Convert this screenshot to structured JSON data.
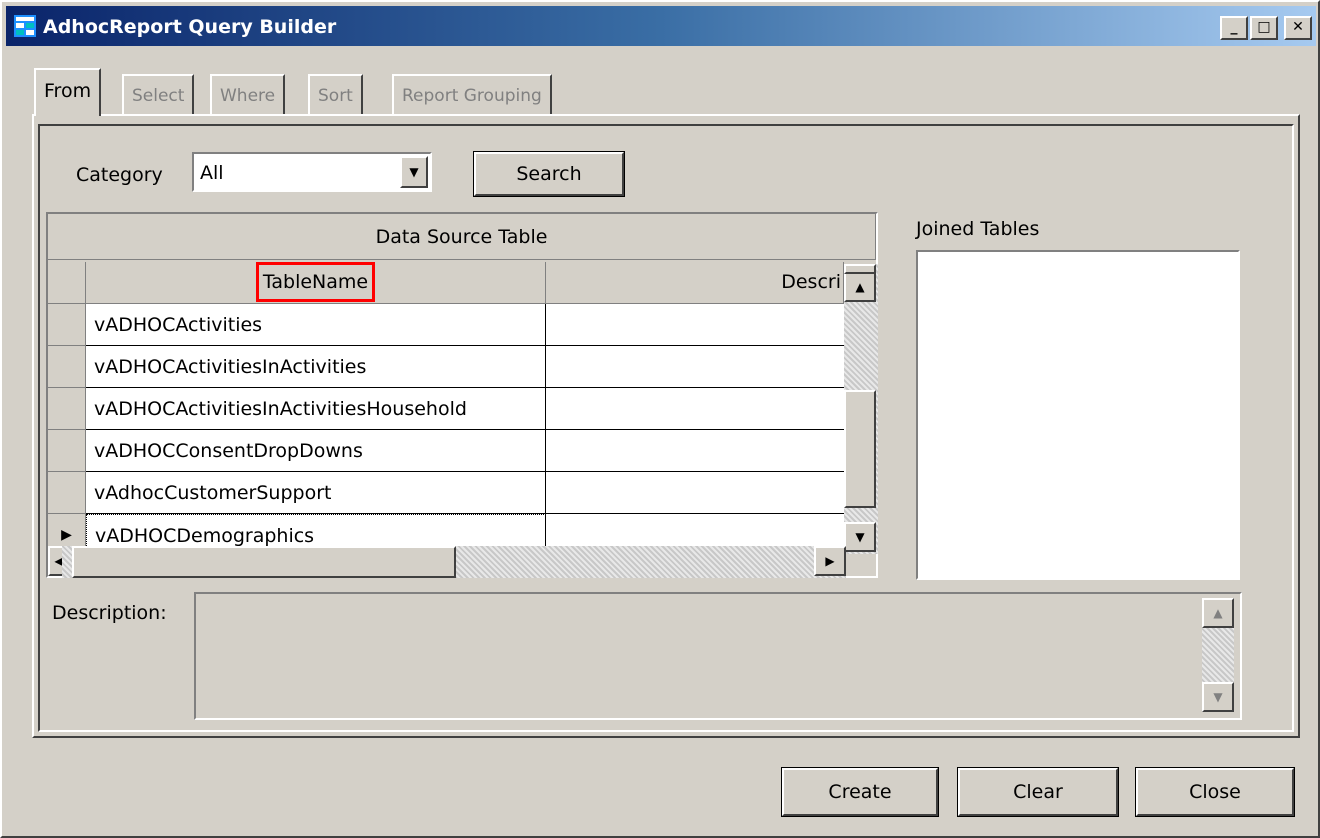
{
  "window": {
    "title": "AdhocReport Query Builder",
    "controls": {
      "minimize": "_",
      "maximize": "□",
      "close": "✕"
    }
  },
  "tabs": [
    {
      "label": "From",
      "active": true
    },
    {
      "label": "Select",
      "active": false
    },
    {
      "label": "Where",
      "active": false
    },
    {
      "label": "Sort",
      "active": false
    },
    {
      "label": "Report Grouping",
      "active": false
    }
  ],
  "filter": {
    "category_label": "Category",
    "category_value": "All",
    "search_label": "Search"
  },
  "grid": {
    "caption": "Data Source Table",
    "columns": [
      "TableName",
      "Descri"
    ],
    "rows": [
      {
        "table_name": "vADHOCActivities",
        "description": ""
      },
      {
        "table_name": "vADHOCActivitiesInActivities",
        "description": ""
      },
      {
        "table_name": "vADHOCActivitiesInActivitiesHousehold",
        "description": ""
      },
      {
        "table_name": "vADHOCConsentDropDowns",
        "description": ""
      },
      {
        "table_name": "vAdhocCustomerSupport",
        "description": ""
      },
      {
        "table_name": "vADHOCDemographics",
        "description": ""
      }
    ],
    "current_row_index": 5
  },
  "joined": {
    "label": "Joined Tables"
  },
  "description": {
    "label": "Description:",
    "value": ""
  },
  "buttons": {
    "create": "Create",
    "clear": "Clear",
    "close": "Close"
  },
  "colors": {
    "highlight_box": "#ff0000",
    "title_start": "#0a246a",
    "title_end": "#a6caf0"
  }
}
